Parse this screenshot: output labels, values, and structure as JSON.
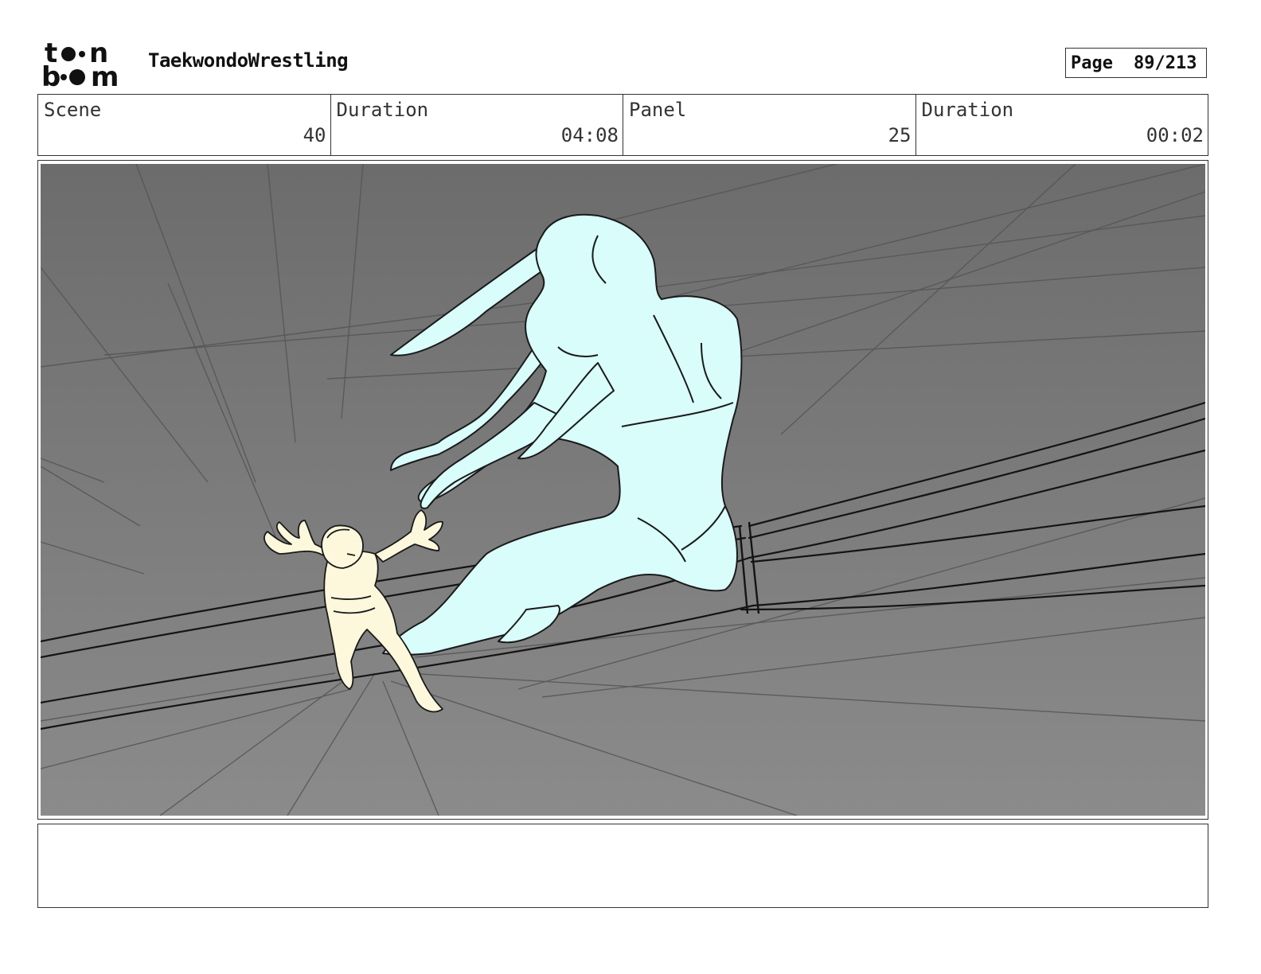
{
  "header": {
    "logo_text": "toon boom",
    "project_title": "TaekwondoWrestling",
    "page_label": "Page",
    "page_value": "89/213"
  },
  "info": {
    "scene_label": "Scene",
    "scene_value": "40",
    "scene_duration_label": "Duration",
    "scene_duration_value": "04:08",
    "panel_label": "Panel",
    "panel_value": "25",
    "panel_duration_label": "Duration",
    "panel_duration_value": "00:02"
  },
  "notes": {
    "text": ""
  },
  "colors": {
    "background_top": "#6e6e6e",
    "background_bottom": "#8a8a8a",
    "giant_fill": "#d8fdfb",
    "small_fill": "#fdf8dc",
    "line": "#1a1a1a"
  }
}
